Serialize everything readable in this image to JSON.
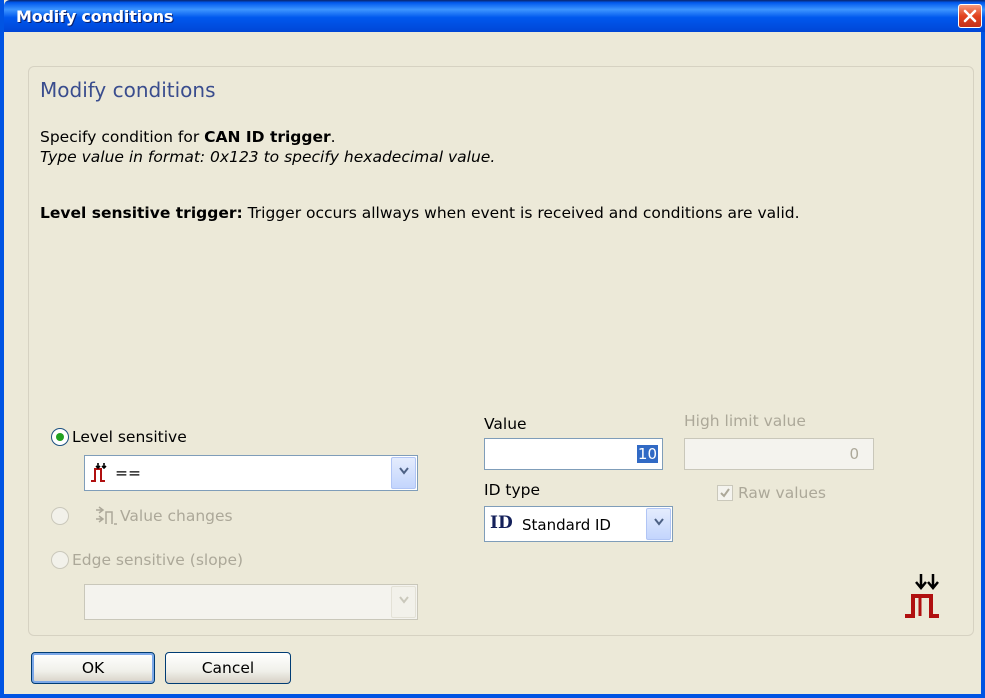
{
  "window": {
    "title": "Modify conditions"
  },
  "panel": {
    "heading": "Modify conditions",
    "desc_prefix": "Specify condition for ",
    "desc_bold": "CAN ID trigger",
    "desc_suffix": ".",
    "hint": "Type value in format: 0x123 to specify hexadecimal value.",
    "mode_bold": "Level sensitive trigger:",
    "mode_text": " Trigger occurs allways when event is received and conditions are valid."
  },
  "trigger_modes": {
    "level": {
      "label": "Level sensitive",
      "checked": true,
      "enabled": true
    },
    "level_operator": "==",
    "value_changes": {
      "label": "Value changes",
      "checked": false,
      "enabled": false
    },
    "edge": {
      "label": "Edge sensitive (slope)",
      "checked": false,
      "enabled": false
    },
    "edge_value": ""
  },
  "value": {
    "label": "Value",
    "value": "10"
  },
  "high_limit": {
    "label": "High limit value",
    "value": "0",
    "enabled": false
  },
  "raw_values": {
    "label": "Raw values",
    "checked": true,
    "enabled": false
  },
  "id_type": {
    "label": "ID type",
    "icon_text": "ID",
    "value": "Standard ID"
  },
  "buttons": {
    "ok": "OK",
    "cancel": "Cancel"
  },
  "colors": {
    "accent": "#0054e3",
    "heading": "#3a4d8e",
    "trigger_icon": "#b01010"
  }
}
